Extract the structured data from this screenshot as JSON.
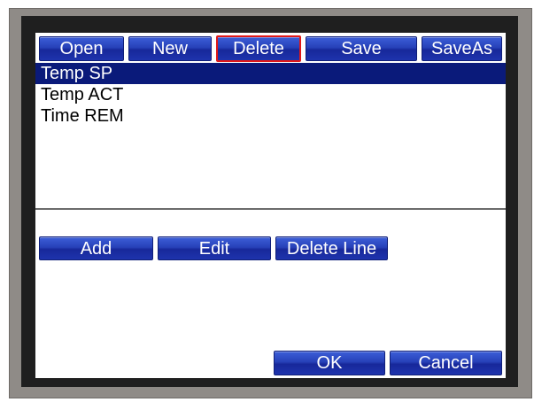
{
  "toolbar": {
    "buttons": [
      {
        "label": "Open",
        "active": false
      },
      {
        "label": "New",
        "active": false
      },
      {
        "label": "Delete",
        "active": true
      },
      {
        "label": "Save",
        "active": false
      },
      {
        "label": "SaveAs",
        "active": false
      }
    ]
  },
  "list": {
    "items": [
      {
        "label": "Temp SP",
        "selected": true
      },
      {
        "label": "Temp ACT",
        "selected": false
      },
      {
        "label": "Time REM",
        "selected": false
      }
    ]
  },
  "line_actions": {
    "add_label": "Add",
    "edit_label": "Edit",
    "delete_line_label": "Delete Line"
  },
  "dialog": {
    "ok_label": "OK",
    "cancel_label": "Cancel"
  },
  "colors": {
    "button_blue": "#2741b8",
    "selected_row": "#0a1a7a",
    "active_border": "#e01818",
    "bezel": "#8f8b87"
  }
}
